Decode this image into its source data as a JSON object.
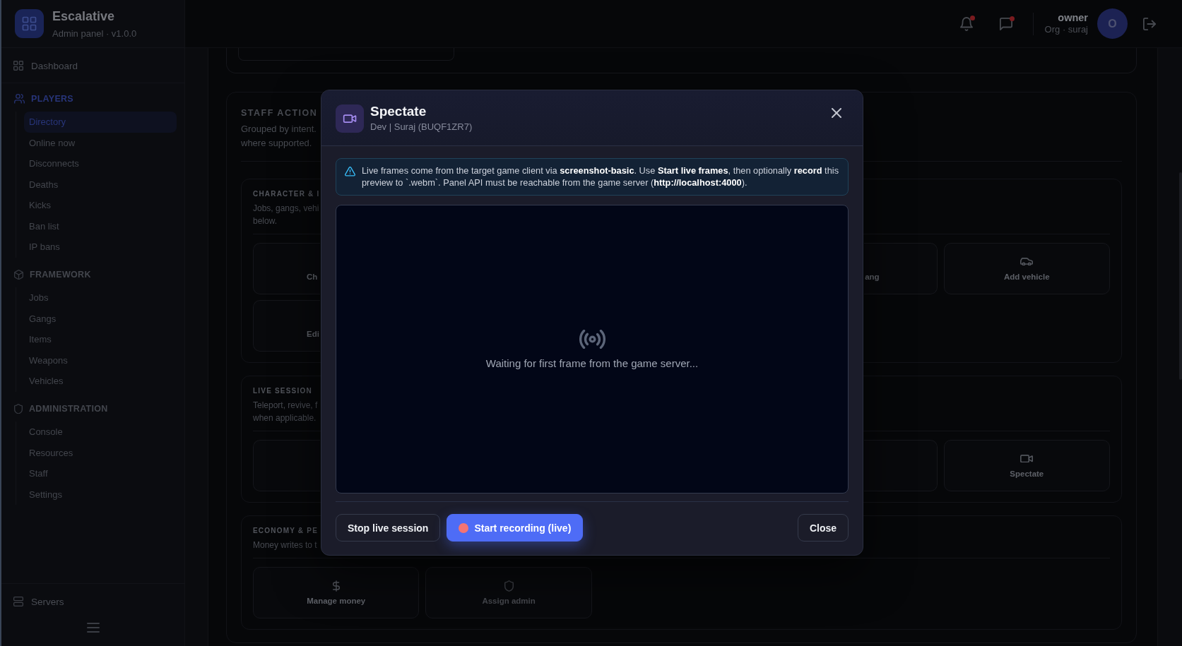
{
  "sidebar": {
    "brand": {
      "name": "Escalative",
      "subtitle": "Admin panel · v1.0.0"
    },
    "top_items": [
      {
        "label": "Dashboard",
        "selected": false
      }
    ],
    "groups": [
      {
        "label": "PLAYERS",
        "items": [
          {
            "label": "Directory",
            "selected": true
          },
          {
            "label": "Online now",
            "selected": false
          },
          {
            "label": "Disconnects",
            "selected": false
          },
          {
            "label": "Deaths",
            "selected": false
          },
          {
            "label": "Kicks",
            "selected": false
          },
          {
            "label": "Ban list",
            "selected": false
          },
          {
            "label": "IP bans",
            "selected": false
          }
        ]
      },
      {
        "label": "FRAMEWORK",
        "items": [
          {
            "label": "Jobs",
            "selected": false
          },
          {
            "label": "Gangs",
            "selected": false
          },
          {
            "label": "Items",
            "selected": false
          },
          {
            "label": "Weapons",
            "selected": false
          },
          {
            "label": "Vehicles",
            "selected": false
          }
        ]
      },
      {
        "label": "ADMINISTRATION",
        "items": [
          {
            "label": "Console",
            "selected": false
          },
          {
            "label": "Resources",
            "selected": false
          },
          {
            "label": "Staff",
            "selected": false
          },
          {
            "label": "Settings",
            "selected": false
          }
        ]
      }
    ],
    "bottom_items": [
      {
        "label": "Servers",
        "selected": false
      }
    ]
  },
  "topbar": {
    "notifications": {
      "unread": true
    },
    "messages": {
      "unread": true
    },
    "user": {
      "name": "owner",
      "org": "Org · suraj",
      "initial": "O"
    }
  },
  "staff_actions": {
    "title": "STAFF ACTION",
    "description_lines": [
      "Grouped by intent.",
      "where supported."
    ],
    "sections": [
      {
        "title": "CHARACTER & I",
        "description_lines": [
          "Jobs, gangs, vehi",
          "below."
        ],
        "rows": [
          {
            "start": [
              {
                "kind": "partial",
                "label": "Ch",
                "disabled": false
              }
            ],
            "end": [
              {
                "kind": "partial",
                "label": "ang",
                "disabled": false
              },
              {
                "kind": "full",
                "label": "Add vehicle",
                "disabled": false
              }
            ]
          },
          {
            "start": [
              {
                "kind": "partial",
                "label": "Edi",
                "disabled": false
              }
            ]
          }
        ]
      },
      {
        "title": "LIVE SESSION",
        "description_lines": [
          "Teleport, revive, f",
          "when applicable."
        ],
        "rows": [
          {
            "start": [
              {
                "kind": "partial"
              }
            ],
            "end": [
              {
                "kind": "partial"
              },
              {
                "kind": "full",
                "label": "Spectate",
                "disabled": false
              }
            ]
          }
        ]
      },
      {
        "title": "ECONOMY & PE",
        "description_lines": [
          "Money writes to t"
        ],
        "rows": [
          {
            "start": [
              {
                "kind": "full",
                "label": "Manage money",
                "disabled": false
              },
              {
                "kind": "full",
                "label": "Assign admin",
                "disabled": true
              }
            ]
          }
        ]
      }
    ]
  },
  "modal": {
    "title": "Spectate",
    "subtitle": "Dev | Suraj (BUQF1ZR7)",
    "notice": "Live frames come from the target game client via **screenshot-basic**. Use **Start live frames**, then optionally **record** this preview to `.webm`. Panel API must be reachable from the game server (**http://localhost:4000**).",
    "preview_message": "Waiting for first frame from the game server...",
    "buttons": [
      {
        "kind": "stop",
        "label": "Stop live session"
      },
      {
        "kind": "record",
        "label": "Start recording (live)"
      },
      {
        "kind": "close",
        "label": "Close"
      }
    ]
  }
}
